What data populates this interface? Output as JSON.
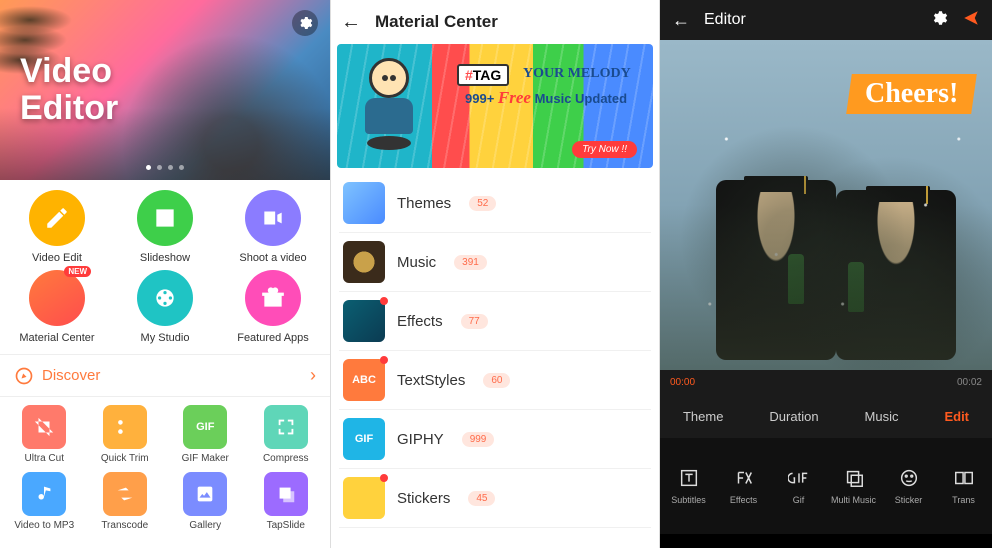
{
  "panel1": {
    "hero_title_line1": "Video",
    "hero_title_line2": "Editor",
    "menu": [
      {
        "label": "Video Edit"
      },
      {
        "label": "Slideshow"
      },
      {
        "label": "Shoot a video"
      },
      {
        "label": "Material Center",
        "badge": "NEW"
      },
      {
        "label": "My Studio"
      },
      {
        "label": "Featured Apps"
      }
    ],
    "discover_label": "Discover",
    "tools": [
      {
        "label": "Ultra Cut"
      },
      {
        "label": "Quick Trim"
      },
      {
        "label": "GIF Maker",
        "thumb_text": "GIF"
      },
      {
        "label": "Compress"
      },
      {
        "label": "Video to MP3"
      },
      {
        "label": "Transcode"
      },
      {
        "label": "Gallery"
      },
      {
        "label": "TapSlide"
      }
    ]
  },
  "panel2": {
    "title": "Material Center",
    "banner": {
      "tag_prefix": "#",
      "tag_text": "TAG",
      "melody": "YOUR MELODY",
      "count": "999+",
      "free": "Free",
      "updated": "Music Updated",
      "cta": "Try Now !!"
    },
    "items": [
      {
        "label": "Themes",
        "count": "52",
        "thumb_text": ""
      },
      {
        "label": "Music",
        "count": "391",
        "thumb_text": ""
      },
      {
        "label": "Effects",
        "count": "77",
        "thumb_text": "",
        "dot": true
      },
      {
        "label": "TextStyles",
        "count": "60",
        "thumb_text": "ABC",
        "dot": true
      },
      {
        "label": "GIPHY",
        "count": "999",
        "thumb_text": "GIF"
      },
      {
        "label": "Stickers",
        "count": "45",
        "thumb_text": "",
        "dot": true
      }
    ]
  },
  "panel3": {
    "title": "Editor",
    "overlay_text": "Cheers!",
    "time_current": "00:00",
    "time_end": "00:02",
    "tabs": [
      {
        "label": "Theme"
      },
      {
        "label": "Duration"
      },
      {
        "label": "Music"
      },
      {
        "label": "Edit",
        "active": true
      }
    ],
    "tools": [
      {
        "label": "Subtitles"
      },
      {
        "label": "Effects"
      },
      {
        "label": "Gif"
      },
      {
        "label": "Multi Music"
      },
      {
        "label": "Sticker"
      },
      {
        "label": "Trans"
      }
    ]
  }
}
